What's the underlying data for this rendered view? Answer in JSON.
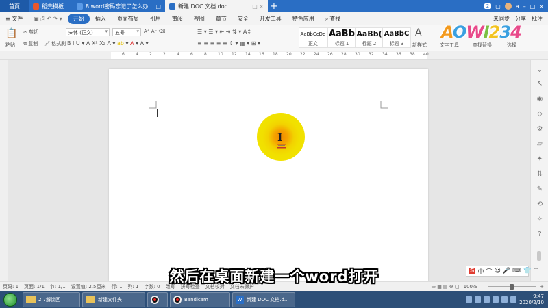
{
  "tabs": {
    "home": "首页",
    "items": [
      {
        "label": "稻壳模板",
        "color": "#e8572d",
        "closable": false
      },
      {
        "label": "8.word密码忘记了怎么办",
        "color": "#2a6ec4",
        "closable": true
      },
      {
        "label": "新建 DOC 文档.doc",
        "color": "#2a6ec4",
        "closable": true
      }
    ],
    "add": "+",
    "badge": "2",
    "user": "a"
  },
  "menu": {
    "file": "≡ 文件",
    "items": [
      "开始",
      "插入",
      "页面布局",
      "引用",
      "审阅",
      "视图",
      "章节",
      "安全",
      "开发工具",
      "特色应用"
    ],
    "active": "开始",
    "search": "查找",
    "right": [
      "未同步",
      "分享",
      "批注"
    ]
  },
  "ribbon": {
    "paste": "粘贴",
    "cut": "剪切",
    "copy": "复制",
    "format_painter": "格式刷",
    "font_name": "宋体 (正文)",
    "font_size": "五号",
    "styles": [
      {
        "sample": "AaBbCcDd",
        "label": "正文"
      },
      {
        "sample": "AaBb",
        "label": "标题 1"
      },
      {
        "sample": "AaBb(",
        "label": "标题 2"
      },
      {
        "sample": "AaBbC",
        "label": "标题 3"
      }
    ],
    "new_style": "新样式",
    "text_tools": "文字工具",
    "find_replace": "查找替换",
    "select": "选择"
  },
  "ruler": {
    "marks": [
      "6",
      "4",
      "2",
      "2",
      "4",
      "6",
      "8",
      "10",
      "12",
      "14",
      "16",
      "18",
      "20",
      "22",
      "24",
      "26",
      "28",
      "30",
      "32",
      "34",
      "36",
      "38",
      "40"
    ]
  },
  "subtitle": "然后在桌面新建一个word打开",
  "logo": "AOWI234",
  "colors": {
    "title_blue": "#2a6ec4",
    "taskbar": "#2d4f78",
    "highlight_yellow": "#f1e000",
    "highlight_orange": "#f08a00"
  },
  "status": {
    "page_num": "页码: 1",
    "pages": "页面: 1/1",
    "section": "节: 1/1",
    "setting": "设置值: 2.5厘米",
    "row": "行: 1",
    "col": "列: 1",
    "words": "字数: 0",
    "revise": "改写",
    "spell": "拼写检查",
    "proof": "文档校对",
    "protect": "文档未保护",
    "zoom": "100%",
    "zoom_fraction": 0.5
  },
  "ime": {
    "brand": "S",
    "lang": "中"
  },
  "taskbar": {
    "items": [
      {
        "label": "2.7解锁回",
        "kind": "folder"
      },
      {
        "label": "新建文件夹",
        "kind": "folder"
      },
      {
        "label": "",
        "kind": "record"
      },
      {
        "label": "Bandicam",
        "kind": "record"
      },
      {
        "label": "新建 DOC 文档.d...",
        "kind": "wps"
      }
    ],
    "time": "9:47",
    "date": "2020/2/10"
  }
}
